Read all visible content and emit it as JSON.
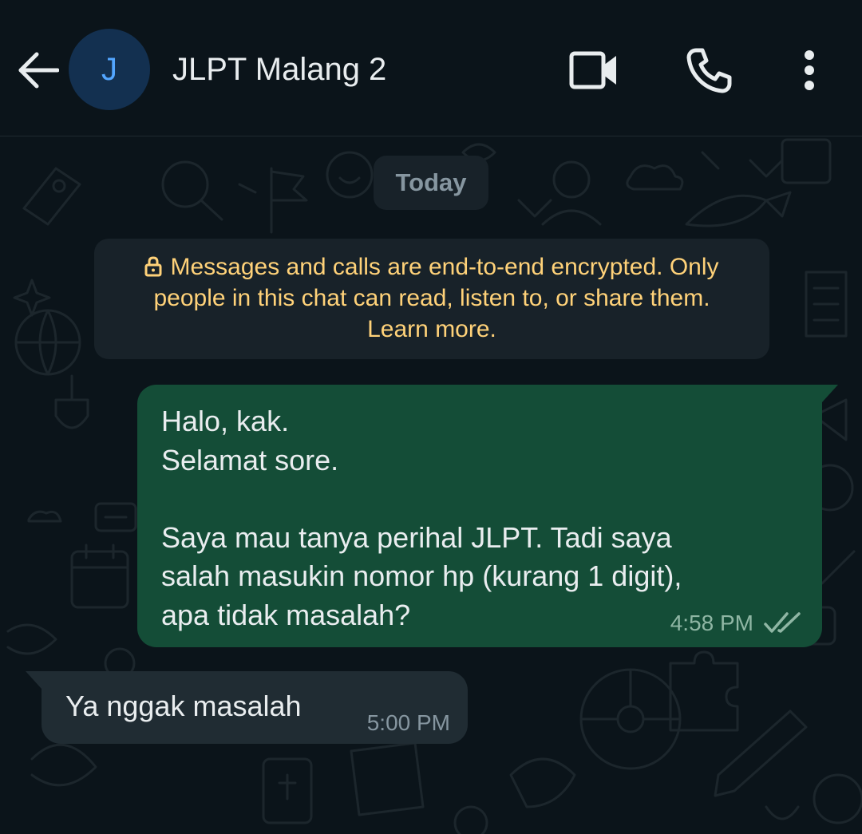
{
  "header": {
    "avatar_letter": "J",
    "title": "JLPT Malang 2",
    "icons": [
      "back-arrow-icon",
      "video-camera-icon",
      "phone-icon",
      "more-vertical-icon"
    ]
  },
  "chat": {
    "date_chip": "Today",
    "encryption_notice": {
      "line1": "Messages and calls are end-to-end encrypted. Only",
      "line2": "people in this chat can read, listen to, or share them.",
      "line3": "Learn more."
    },
    "messages": [
      {
        "direction": "outgoing",
        "text": "Halo, kak.\nSelamat sore.\n\nSaya mau tanya perihal JLPT. Tadi saya\nsalah masukin nomor hp (kurang 1 digit),\napa tidak masalah?",
        "time": "4:58 PM",
        "status": "delivered"
      },
      {
        "direction": "incoming",
        "text": "Ya nggak masalah",
        "time": "5:00 PM"
      }
    ]
  },
  "colors": {
    "background": "#0b141a",
    "outgoing_bubble": "#144d37",
    "incoming_bubble": "#202c33",
    "notice_text": "#ffd279",
    "avatar_bg": "#133050",
    "avatar_letter": "#53a6ff"
  }
}
